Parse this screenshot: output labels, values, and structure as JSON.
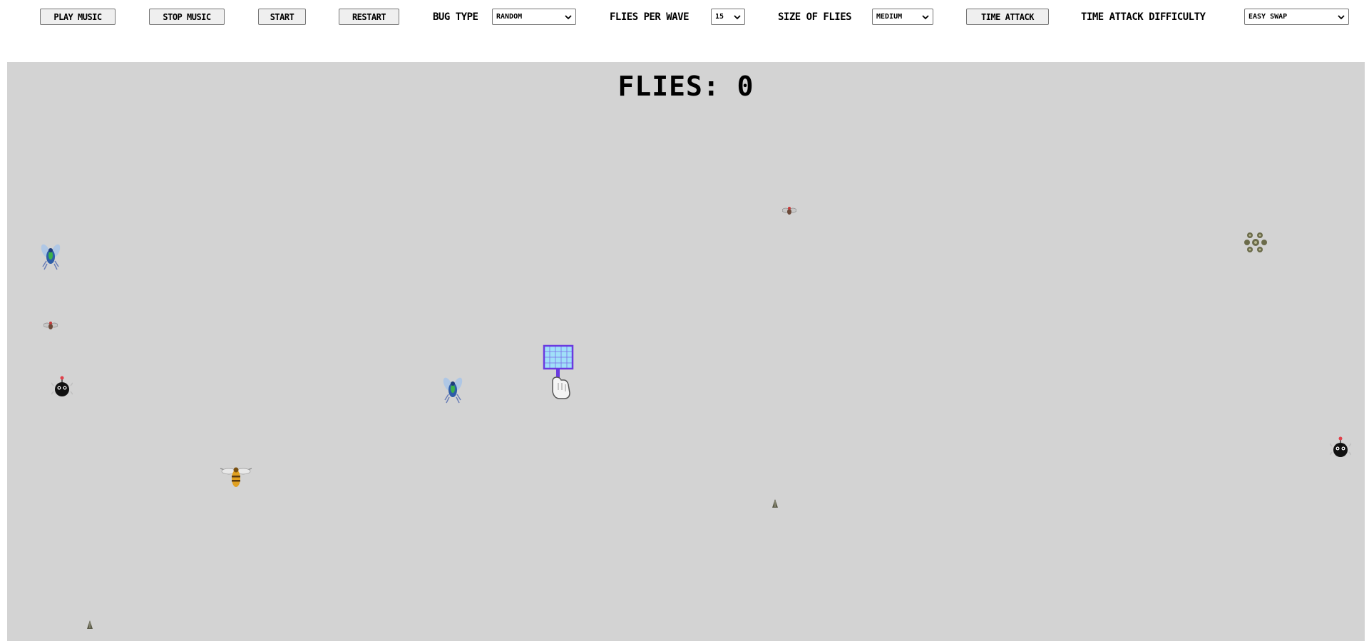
{
  "toolbar": {
    "play_music_label": "PLAY MUSIC",
    "stop_music_label": "STOP MUSIC",
    "start_label": "START",
    "restart_label": "RESTART",
    "bug_type_label": "BUG TYPE",
    "bug_type_value": "RANDOM",
    "flies_per_wave_label": "FLIES PER WAVE",
    "flies_per_wave_value": "15",
    "size_of_flies_label": "SIZE OF FLIES",
    "size_of_flies_value": "MEDIUM",
    "time_attack_label": "TIME ATTACK",
    "time_attack_difficulty_label": "TIME ATTACK DIFFICULTY",
    "time_attack_difficulty_value": "EASY SWAP"
  },
  "game": {
    "score_text": "FLIES: 0",
    "background_color": "#d3d3d3",
    "bugs": [
      {
        "type": "blue-fly-icon"
      },
      {
        "type": "blue-fly-icon"
      },
      {
        "type": "small-fly-icon"
      },
      {
        "type": "small-fly-icon"
      },
      {
        "type": "black-bug-icon"
      },
      {
        "type": "black-bug-icon"
      },
      {
        "type": "wasp-icon"
      },
      {
        "type": "spider-cluster-icon"
      },
      {
        "type": "tiny-bug-icon"
      },
      {
        "type": "tiny-bug-icon"
      }
    ],
    "cursor": "fly-swatter-cursor-icon"
  }
}
